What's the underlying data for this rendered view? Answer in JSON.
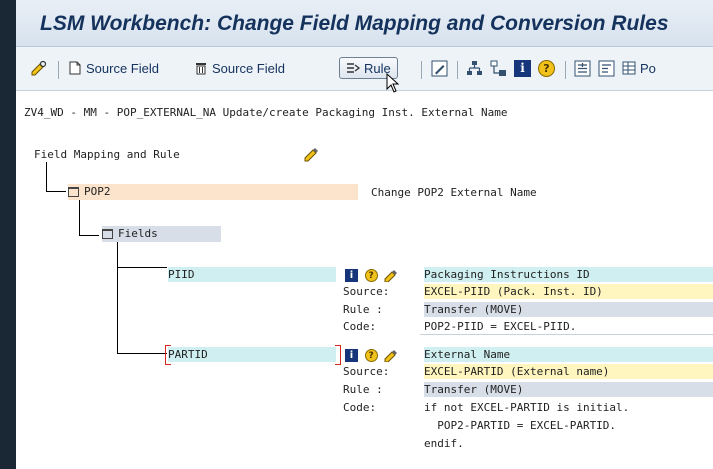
{
  "window": {
    "title": "LSM Workbench: Change Field Mapping and Conversion Rules"
  },
  "toolbar": {
    "source_field_label": "Source Field",
    "delete_source_field_label": "Source Field",
    "rule_label": "Rule",
    "overflow_label": "Po"
  },
  "header": {
    "text": "ZV4_WD - MM - POP_EXTERNAL_NA Update/create Packaging Inst. External Name"
  },
  "tree": {
    "root_label": "Field Mapping and Rule",
    "segment": {
      "name": "POP2",
      "description": "Change POP2 External Name"
    },
    "fields_label": "Fields",
    "fields": [
      {
        "name": "PIID",
        "description": "Packaging Instructions ID",
        "source_key": "Source:",
        "source_value": "EXCEL-PIID (Pack. Inst. ID)",
        "rule_key": "Rule :",
        "rule_value": "Transfer (MOVE)",
        "code_key": "Code:",
        "code_lines": [
          "POP2-PIID = EXCEL-PIID."
        ]
      },
      {
        "name": "PARTID",
        "description": "External Name",
        "source_key": "Source:",
        "source_value": "EXCEL-PARTID (External name)",
        "rule_key": "Rule :",
        "rule_value": "Transfer (MOVE)",
        "code_key": "Code:",
        "code_lines": [
          "if not EXCEL-PARTID is initial.",
          "  POP2-PARTID = EXCEL-PARTID.",
          "endif."
        ]
      }
    ]
  },
  "colors": {
    "title": "#14325c",
    "segment_highlight": "#fce4cc",
    "field_highlight": "#cfeff1",
    "source_highlight": "#fff6bf",
    "rule_highlight": "#d7dee8"
  }
}
